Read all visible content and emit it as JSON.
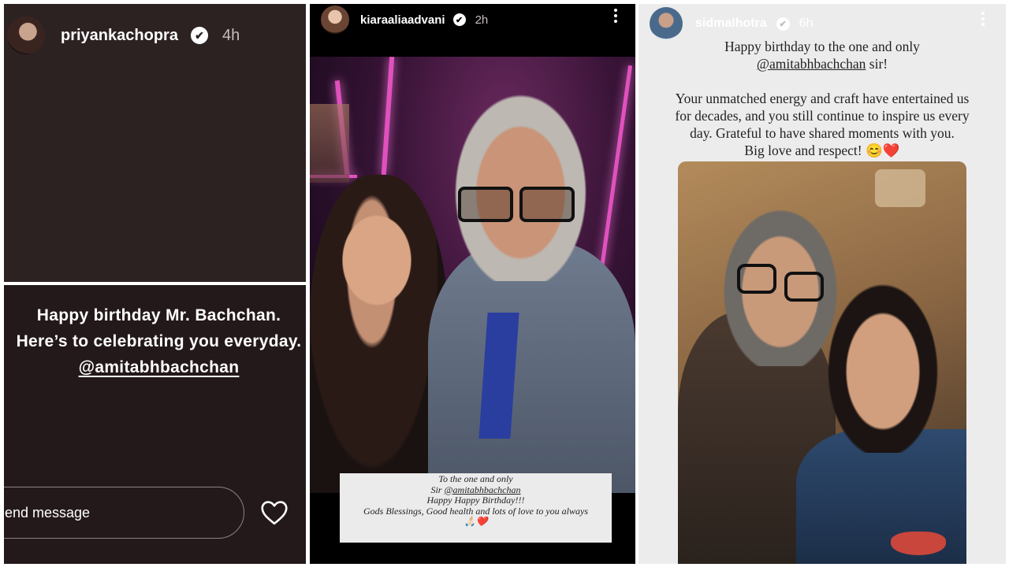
{
  "panel1": {
    "username": "priyankachopra",
    "verified_glyph": "✔",
    "time": "4h",
    "caption": {
      "line1": "Happy birthday Mr. Bachchan.",
      "line2": "Here’s to celebrating you everyday.",
      "mention": "@amitabhbachchan"
    },
    "message_placeholder": "end message",
    "heart_icon": "heart-outline-icon"
  },
  "panel2": {
    "username": "kiaraaliaadvani",
    "verified_glyph": "✔",
    "time": "2h",
    "menu_icon": "more-vertical-icon",
    "photo_caption": {
      "line1": "To the one and only",
      "line2_prefix": "Sir ",
      "mention": "@amitabhbachchan",
      "line3": "Happy Happy Birthday!!!",
      "line4": "Gods Blessings, Good health and lots of love to you always",
      "emoji": "🙏🏻❤️"
    }
  },
  "panel3": {
    "username": "sidmalhotra",
    "verified_glyph": "✔",
    "time": "6h",
    "menu_icon": "more-vertical-icon",
    "text": {
      "line1": "Happy birthday to the one and only",
      "mention": "@amitabhbachchan",
      "line2_suffix": " sir!",
      "para2_line1": "Your unmatched energy and craft have entertained us",
      "para2_line2": "for decades, and you still continue to inspire us every",
      "para2_line3": "day. Grateful to have shared moments with you.",
      "para2_line4": "Big love and respect! 😊❤️"
    }
  },
  "colors": {
    "panel1_top_bg": "#2c2221",
    "panel1_bottom_bg": "#24191a",
    "panel2_bg": "#000000",
    "panel3_bg": "#ececec",
    "stage_light": "#ff5cd6",
    "caption_bg": "#ebebeb"
  }
}
